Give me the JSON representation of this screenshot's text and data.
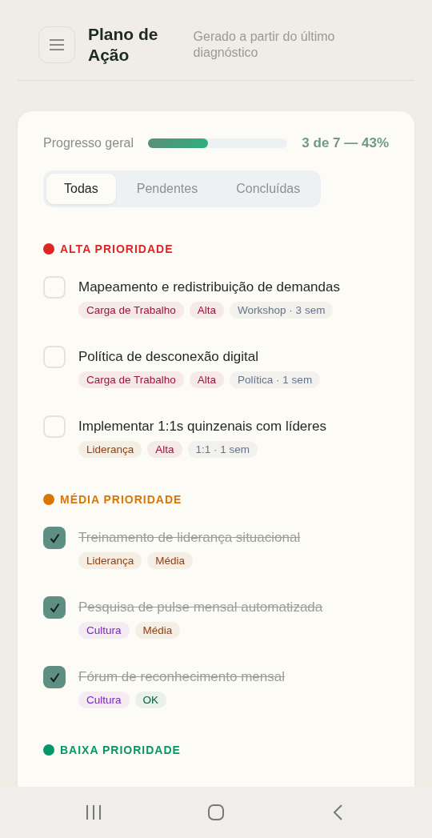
{
  "header": {
    "title_line_1": "Plano de",
    "title_line_2": "Ação",
    "subtitle": "Gerado a partir do último diagnóstico"
  },
  "progress": {
    "label": "Progresso geral",
    "level": 0.43,
    "reading": "3 de 7 — 43%"
  },
  "tabs": [
    {
      "label": "Todas",
      "selected": true
    },
    {
      "label": "Pendentes",
      "selected": false
    },
    {
      "label": "Concluídas",
      "selected": false
    }
  ],
  "sections": [
    {
      "title": "ALTA PRIORIDADE",
      "color": "#dc2626",
      "tasks": [
        {
          "title": "Mapeamento e redistribuição de demandas",
          "checked": false,
          "tags": [
            {
              "label": "Carga de Trabalho",
              "color": "#9f1239"
            },
            {
              "label": "Alta",
              "color": "#9f1239"
            },
            {
              "label": "Workshop · 3 sem",
              "color": "#64748b"
            }
          ]
        },
        {
          "title": "Política de desconexão digital",
          "checked": false,
          "tags": [
            {
              "label": "Carga de Trabalho",
              "color": "#9f1239"
            },
            {
              "label": "Alta",
              "color": "#9f1239"
            },
            {
              "label": "Política · 1 sem",
              "color": "#64748b"
            }
          ]
        },
        {
          "title": "Implementar 1:1s quinzenais com líderes",
          "checked": false,
          "tags": [
            {
              "label": "Liderança",
              "color": "#92400e"
            },
            {
              "label": "Alta",
              "color": "#9f1239"
            },
            {
              "label": "1:1 · 1 sem",
              "color": "#64748b"
            }
          ]
        }
      ]
    },
    {
      "title": "MÉDIA PRIORIDADE",
      "color": "#d97706",
      "tasks": [
        {
          "title": "Treinamento de liderança situacional",
          "checked": true,
          "tags": [
            {
              "label": "Liderança",
              "color": "#92400e"
            },
            {
              "label": "Média",
              "color": "#92400e"
            }
          ]
        },
        {
          "title": "Pesquisa de pulse mensal automatizada",
          "checked": true,
          "tags": [
            {
              "label": "Cultura",
              "color": "#7e22ce"
            },
            {
              "label": "Média",
              "color": "#92400e"
            }
          ]
        },
        {
          "title": "Fórum de reconhecimento mensal",
          "checked": true,
          "tags": [
            {
              "label": "Cultura",
              "color": "#7e22ce"
            },
            {
              "label": "OK",
              "color": "#065f46"
            }
          ]
        }
      ]
    },
    {
      "title": "BAIXA PRIORIDADE",
      "color": "#059669"
    }
  ]
}
